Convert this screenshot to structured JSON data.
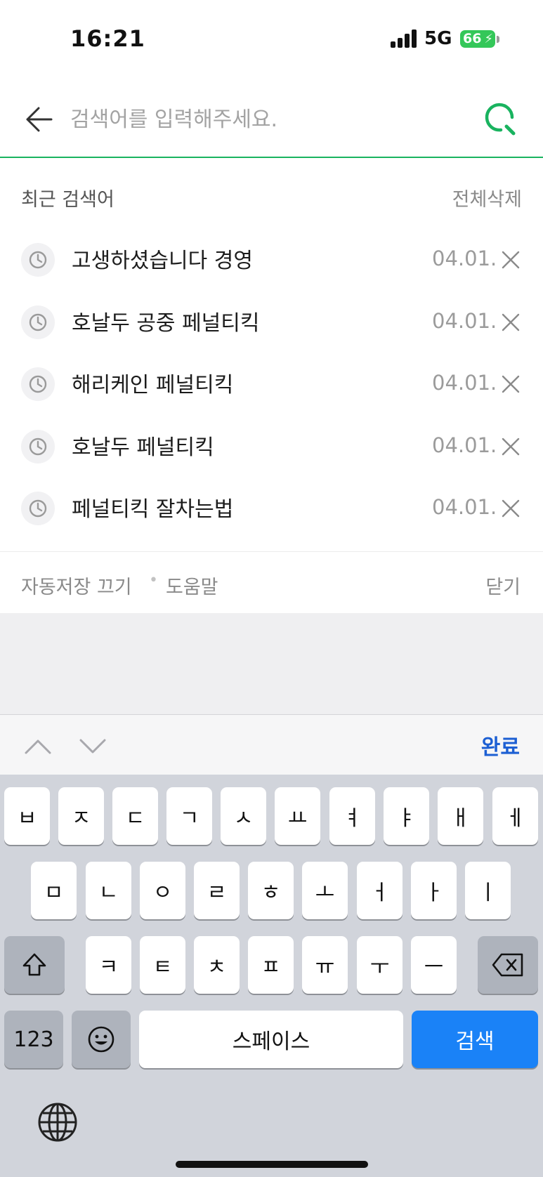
{
  "status_bar": {
    "time": "16:21",
    "network": "5G",
    "battery": "66"
  },
  "search": {
    "placeholder": "검색어를 입력해주세요.",
    "accent_color": "#19b35f",
    "back_icon": "arrow-left-icon",
    "search_icon": "search-icon"
  },
  "recent": {
    "title": "최근 검색어",
    "delete_all": "전체삭제",
    "items": [
      {
        "text": "고생하셨습니다 경영",
        "date": "04.01."
      },
      {
        "text": "호날두 공중 페널티킥",
        "date": "04.01."
      },
      {
        "text": "해리케인 페널티킥",
        "date": "04.01."
      },
      {
        "text": "호날두 페널티킥",
        "date": "04.01."
      },
      {
        "text": "페널티킥 잘차는법",
        "date": "04.01."
      }
    ]
  },
  "footer": {
    "auto_save": "자동저장 끄기",
    "separator": "•",
    "help": "도움말",
    "close": "닫기"
  },
  "accessory": {
    "done": "완료"
  },
  "keyboard": {
    "row1": [
      "ㅂ",
      "ㅈ",
      "ㄷ",
      "ㄱ",
      "ㅅ",
      "ㅛ",
      "ㅕ",
      "ㅑ",
      "ㅐ",
      "ㅔ"
    ],
    "row2": [
      "ㅁ",
      "ㄴ",
      "ㅇ",
      "ㄹ",
      "ㅎ",
      "ㅗ",
      "ㅓ",
      "ㅏ",
      "ㅣ"
    ],
    "row3": [
      "ㅋ",
      "ㅌ",
      "ㅊ",
      "ㅍ",
      "ㅠ",
      "ㅜ",
      "ㅡ"
    ],
    "numbers": "123",
    "space": "스페이스",
    "search": "검색",
    "search_color": "#1a82f7"
  }
}
